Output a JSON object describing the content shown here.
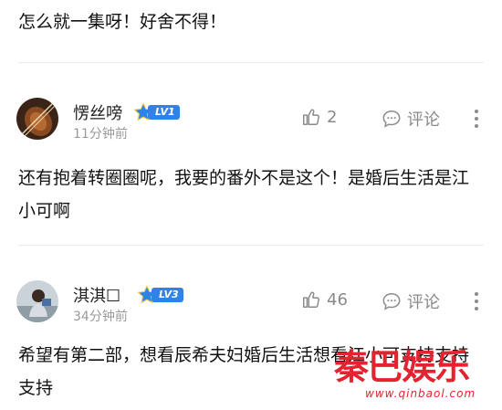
{
  "top_comment": {
    "text": "怎么就一集呀！好舍不得！"
  },
  "comments": [
    {
      "username": "愣丝嗙",
      "level": "LV1",
      "time": "11分钟前",
      "likes": "2",
      "reply_label": "评论",
      "text": "还有抱着转圈圈呢，我要的番外不是这个！是婚后生活是江小可啊"
    },
    {
      "username": "淇淇☐",
      "level": "LV3",
      "time": "34分钟前",
      "likes": "46",
      "reply_label": "评论",
      "text": "希望有第二部，想看辰希夫妇婚后生活想看江小可支持支持支持"
    }
  ],
  "watermark": {
    "brand": "秦巴娱乐",
    "url": "www.qinbaol.com"
  },
  "colors": {
    "badge": "#2f83e6",
    "watermark": "#e3232f",
    "meta": "#9a9a9a"
  }
}
